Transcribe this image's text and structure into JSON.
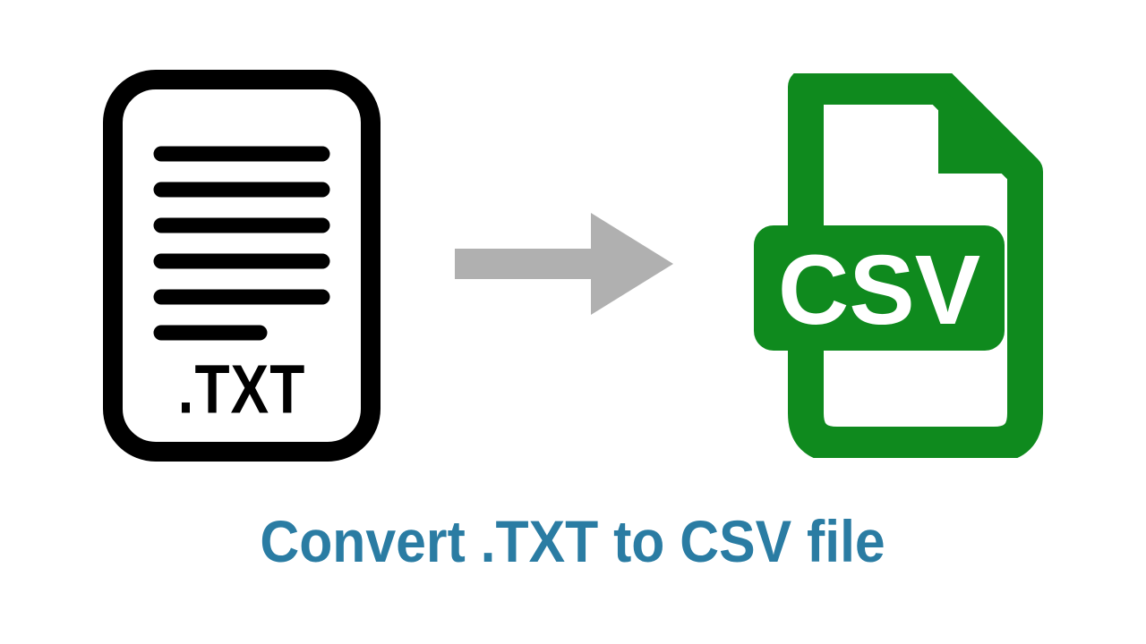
{
  "txt_icon": {
    "extension_label": ".TXT",
    "color": "#000000"
  },
  "csv_icon": {
    "badge_label": "CSV",
    "color": "#0f8a1e"
  },
  "arrow": {
    "color": "#b0b0b0"
  },
  "caption": "Convert .TXT to CSV file",
  "caption_color": "#2a7ca3"
}
